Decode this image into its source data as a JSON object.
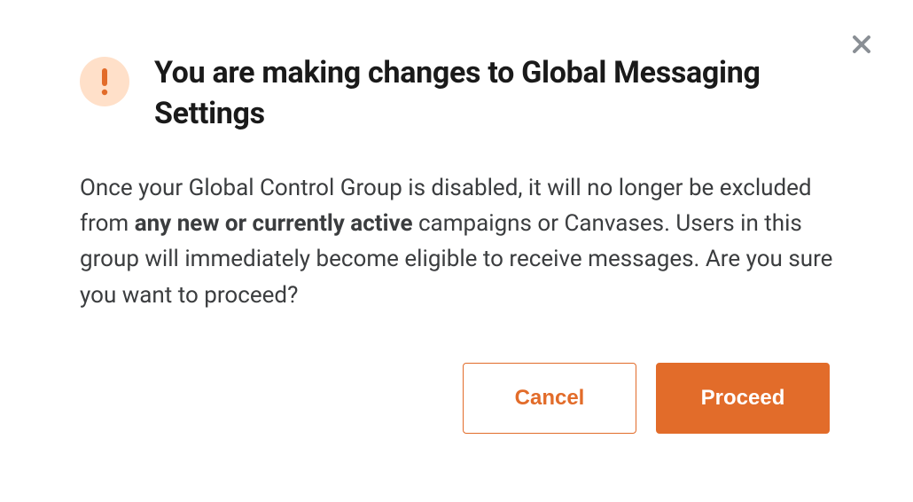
{
  "modal": {
    "title": "You are making changes to Global Messaging Settings",
    "body_before": "Once your Global Control Group is disabled, it will no longer be excluded from ",
    "body_bold": "any new or currently active",
    "body_after": " campaigns or Canvases. Users in this group will immediately become eligible to receive messages. Are you sure you want to proceed?",
    "buttons": {
      "cancel_label": "Cancel",
      "proceed_label": "Proceed"
    },
    "icon": "warning-icon",
    "colors": {
      "accent": "#e26c2a",
      "icon_bg": "#ffe0c9"
    }
  }
}
